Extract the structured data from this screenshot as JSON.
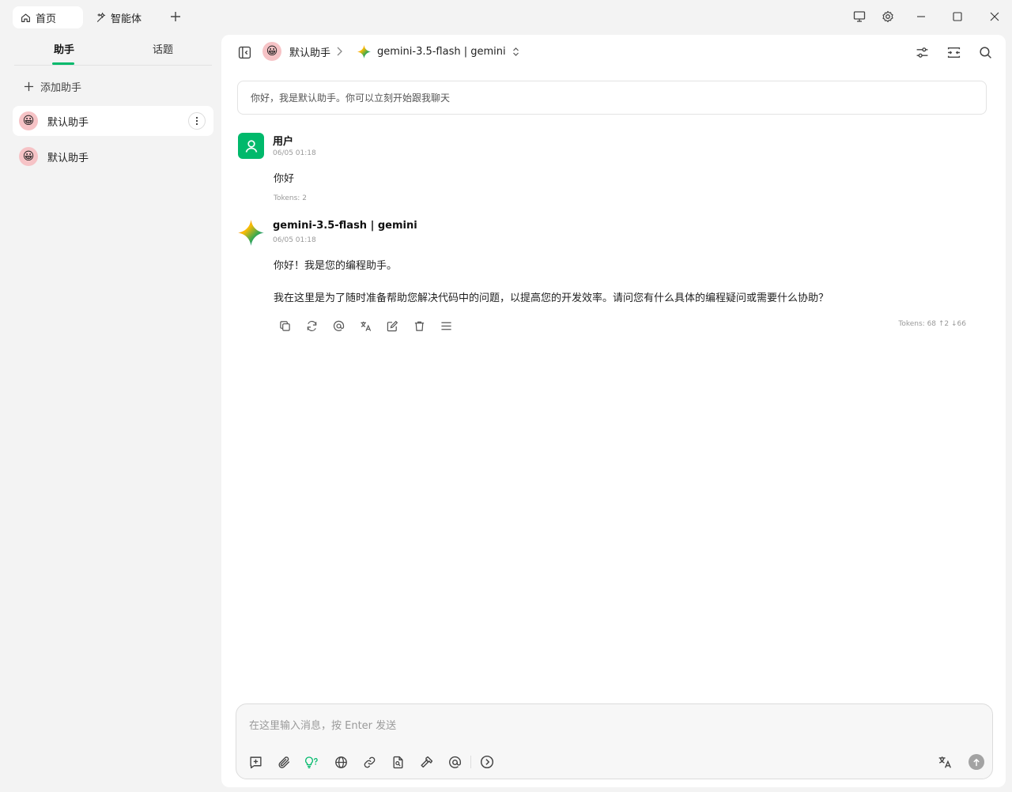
{
  "tabs": {
    "home": "首页",
    "agents": "智能体"
  },
  "sidebar": {
    "tab_assistants": "助手",
    "tab_topics": "话题",
    "add_assistant": "添加助手",
    "assistants": [
      {
        "name": "默认助手",
        "avatar": "😀"
      },
      {
        "name": "默认助手",
        "avatar": "😀"
      }
    ]
  },
  "header": {
    "assistant_name": "默认助手",
    "avatar": "😀",
    "model_label": "gemini-3.5-flash | gemini"
  },
  "welcome": "你好，我是默认助手。你可以立刻开始跟我聊天",
  "messages": [
    {
      "sender": "用户",
      "time": "06/05 01:18",
      "text": "你好",
      "tokens": "Tokens: 2"
    },
    {
      "sender": "gemini-3.5-flash | gemini",
      "time": "06/05 01:18",
      "line1": "你好！我是您的编程助手。",
      "line2": "我在这里是为了随时准备帮助您解决代码中的问题，以提高您的开发效率。请问您有什么具体的编程疑问或需要什么协助？",
      "tokens": "Tokens: 68 ↑2 ↓66"
    }
  ],
  "input": {
    "placeholder": "在这里输入消息，按 Enter 发送"
  },
  "colors": {
    "accent": "#00b96b",
    "user_avatar": "#00b96b"
  }
}
